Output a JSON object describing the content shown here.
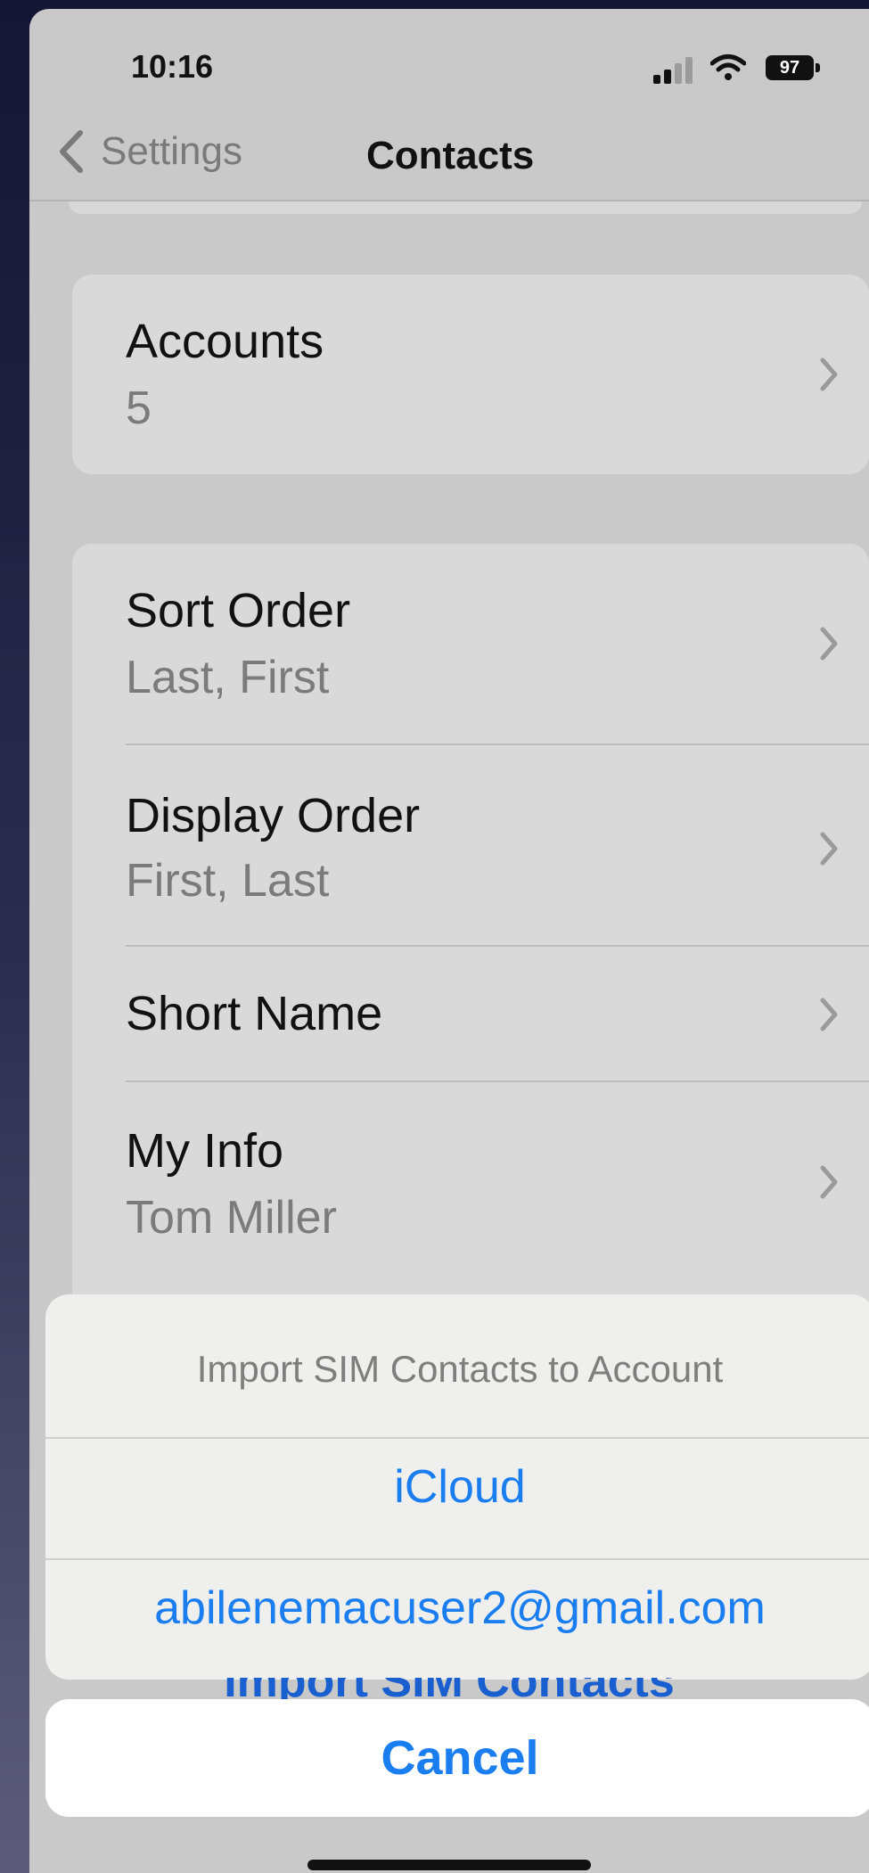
{
  "status_bar": {
    "time": "10:16",
    "battery_level": "97",
    "icons": [
      "signal-icon",
      "wifi-icon",
      "battery-icon"
    ]
  },
  "nav": {
    "back_label": "Settings",
    "title": "Contacts"
  },
  "groups": {
    "accounts": {
      "title": "Accounts",
      "value": "5"
    },
    "sort_order": {
      "title": "Sort Order",
      "value": "Last, First"
    },
    "display_order": {
      "title": "Display Order",
      "value": "First, Last"
    },
    "short_name": {
      "title": "Short Name"
    },
    "my_info": {
      "title": "My Info",
      "value": "Tom Miller"
    }
  },
  "action_sheet": {
    "title": "Import SIM Contacts to Account",
    "options": [
      "iCloud",
      "abilenemacuser2@gmail.com"
    ],
    "cancel_label": "Cancel"
  },
  "background_row_peek": "Import SIM Contacts",
  "colors": {
    "accent": "#1a7ef0",
    "screen_bg": "#c9c9c9",
    "group_bg": "#d9d9d9",
    "sheet_bg": "#efefed"
  }
}
